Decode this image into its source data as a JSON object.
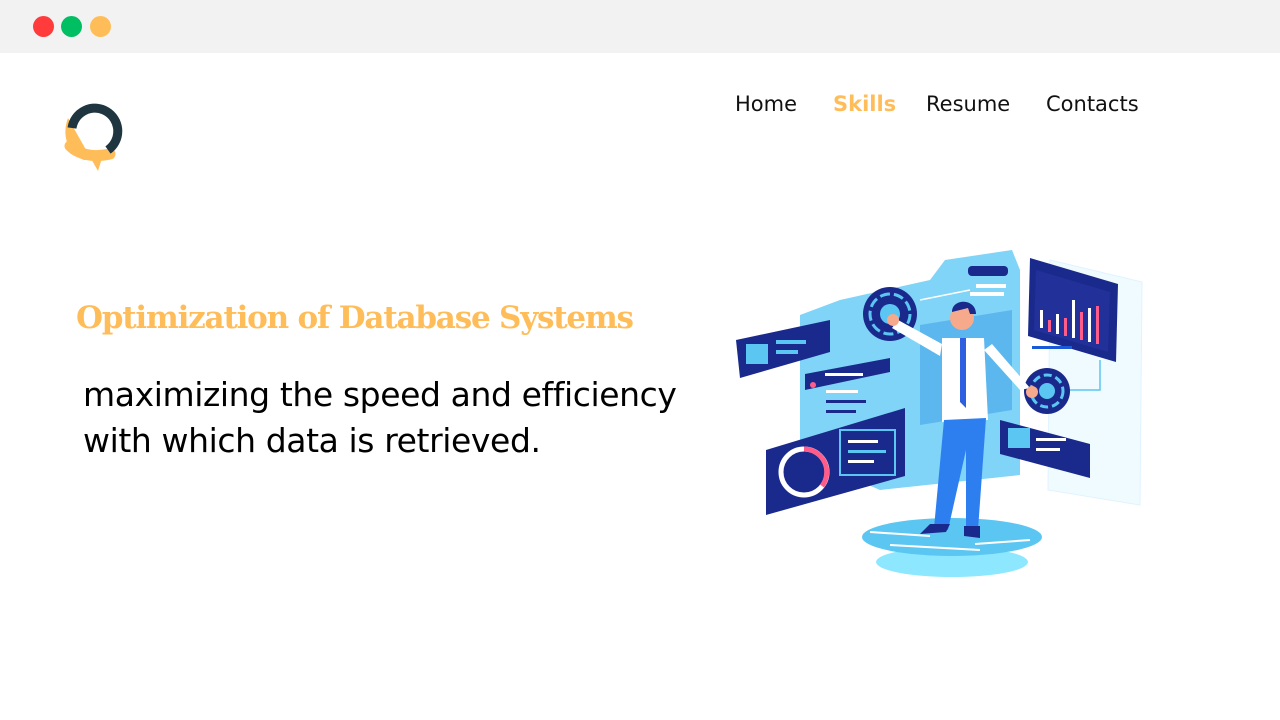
{
  "window": {
    "controls": [
      {
        "name": "close",
        "color": "#ff3b3b"
      },
      {
        "name": "maximize",
        "color": "#00bf63"
      },
      {
        "name": "minimize",
        "color": "#ffbd59"
      }
    ]
  },
  "brand": {
    "logo_icon": "chat-pin-logo",
    "colors": {
      "dark": "#1f3540",
      "accent": "#ffbd59"
    }
  },
  "nav": {
    "items": [
      {
        "label": "Home",
        "active": false
      },
      {
        "label": "Skills",
        "active": true
      },
      {
        "label": "Resume",
        "active": false
      },
      {
        "label": "Contacts",
        "active": false
      }
    ],
    "active_color": "#ffbd59"
  },
  "hero": {
    "title": "Optimization of Database Systems",
    "description_line1": "maximizing the speed and efficiency",
    "description_line2": "with which data is retrieved.",
    "illustration_icon": "data-analyst-dashboard-illustration"
  }
}
